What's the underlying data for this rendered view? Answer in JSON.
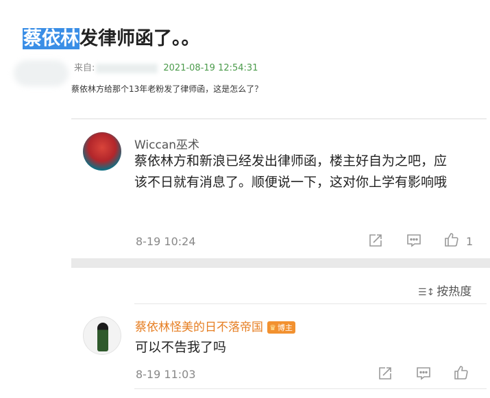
{
  "post": {
    "title_highlight": "蔡依林",
    "title_rest": "发律师函了。。",
    "from_label": "来自:",
    "timestamp": "2021-08-19 12:54:31",
    "body": "蔡依林方给那个13年老粉发了律师函，这是怎么了？"
  },
  "comments": [
    {
      "username": "Wiccan巫术",
      "text": "蔡依林方和新浪已经发出律师函，楼主好自为之吧，应该不日就有消息了。顺便说一下，这对你上学有影响哦",
      "date": "8-19 10:24",
      "like_count": "1"
    },
    {
      "username": "蔡依林怪美的日不落帝国",
      "badge": "博主",
      "text": "可以不告我了吗",
      "date": "8-19 11:03"
    }
  ],
  "sort": {
    "label": "按热度"
  },
  "icons": {
    "repost": "repost-icon",
    "comment": "comment-icon",
    "like": "like-icon",
    "sort": "sort-icon",
    "crown": "crown-icon"
  },
  "colors": {
    "highlight": "#3a8ee6",
    "timestamp": "#4a9a4a",
    "op_name": "#e67e22",
    "badge": "#f29130"
  }
}
